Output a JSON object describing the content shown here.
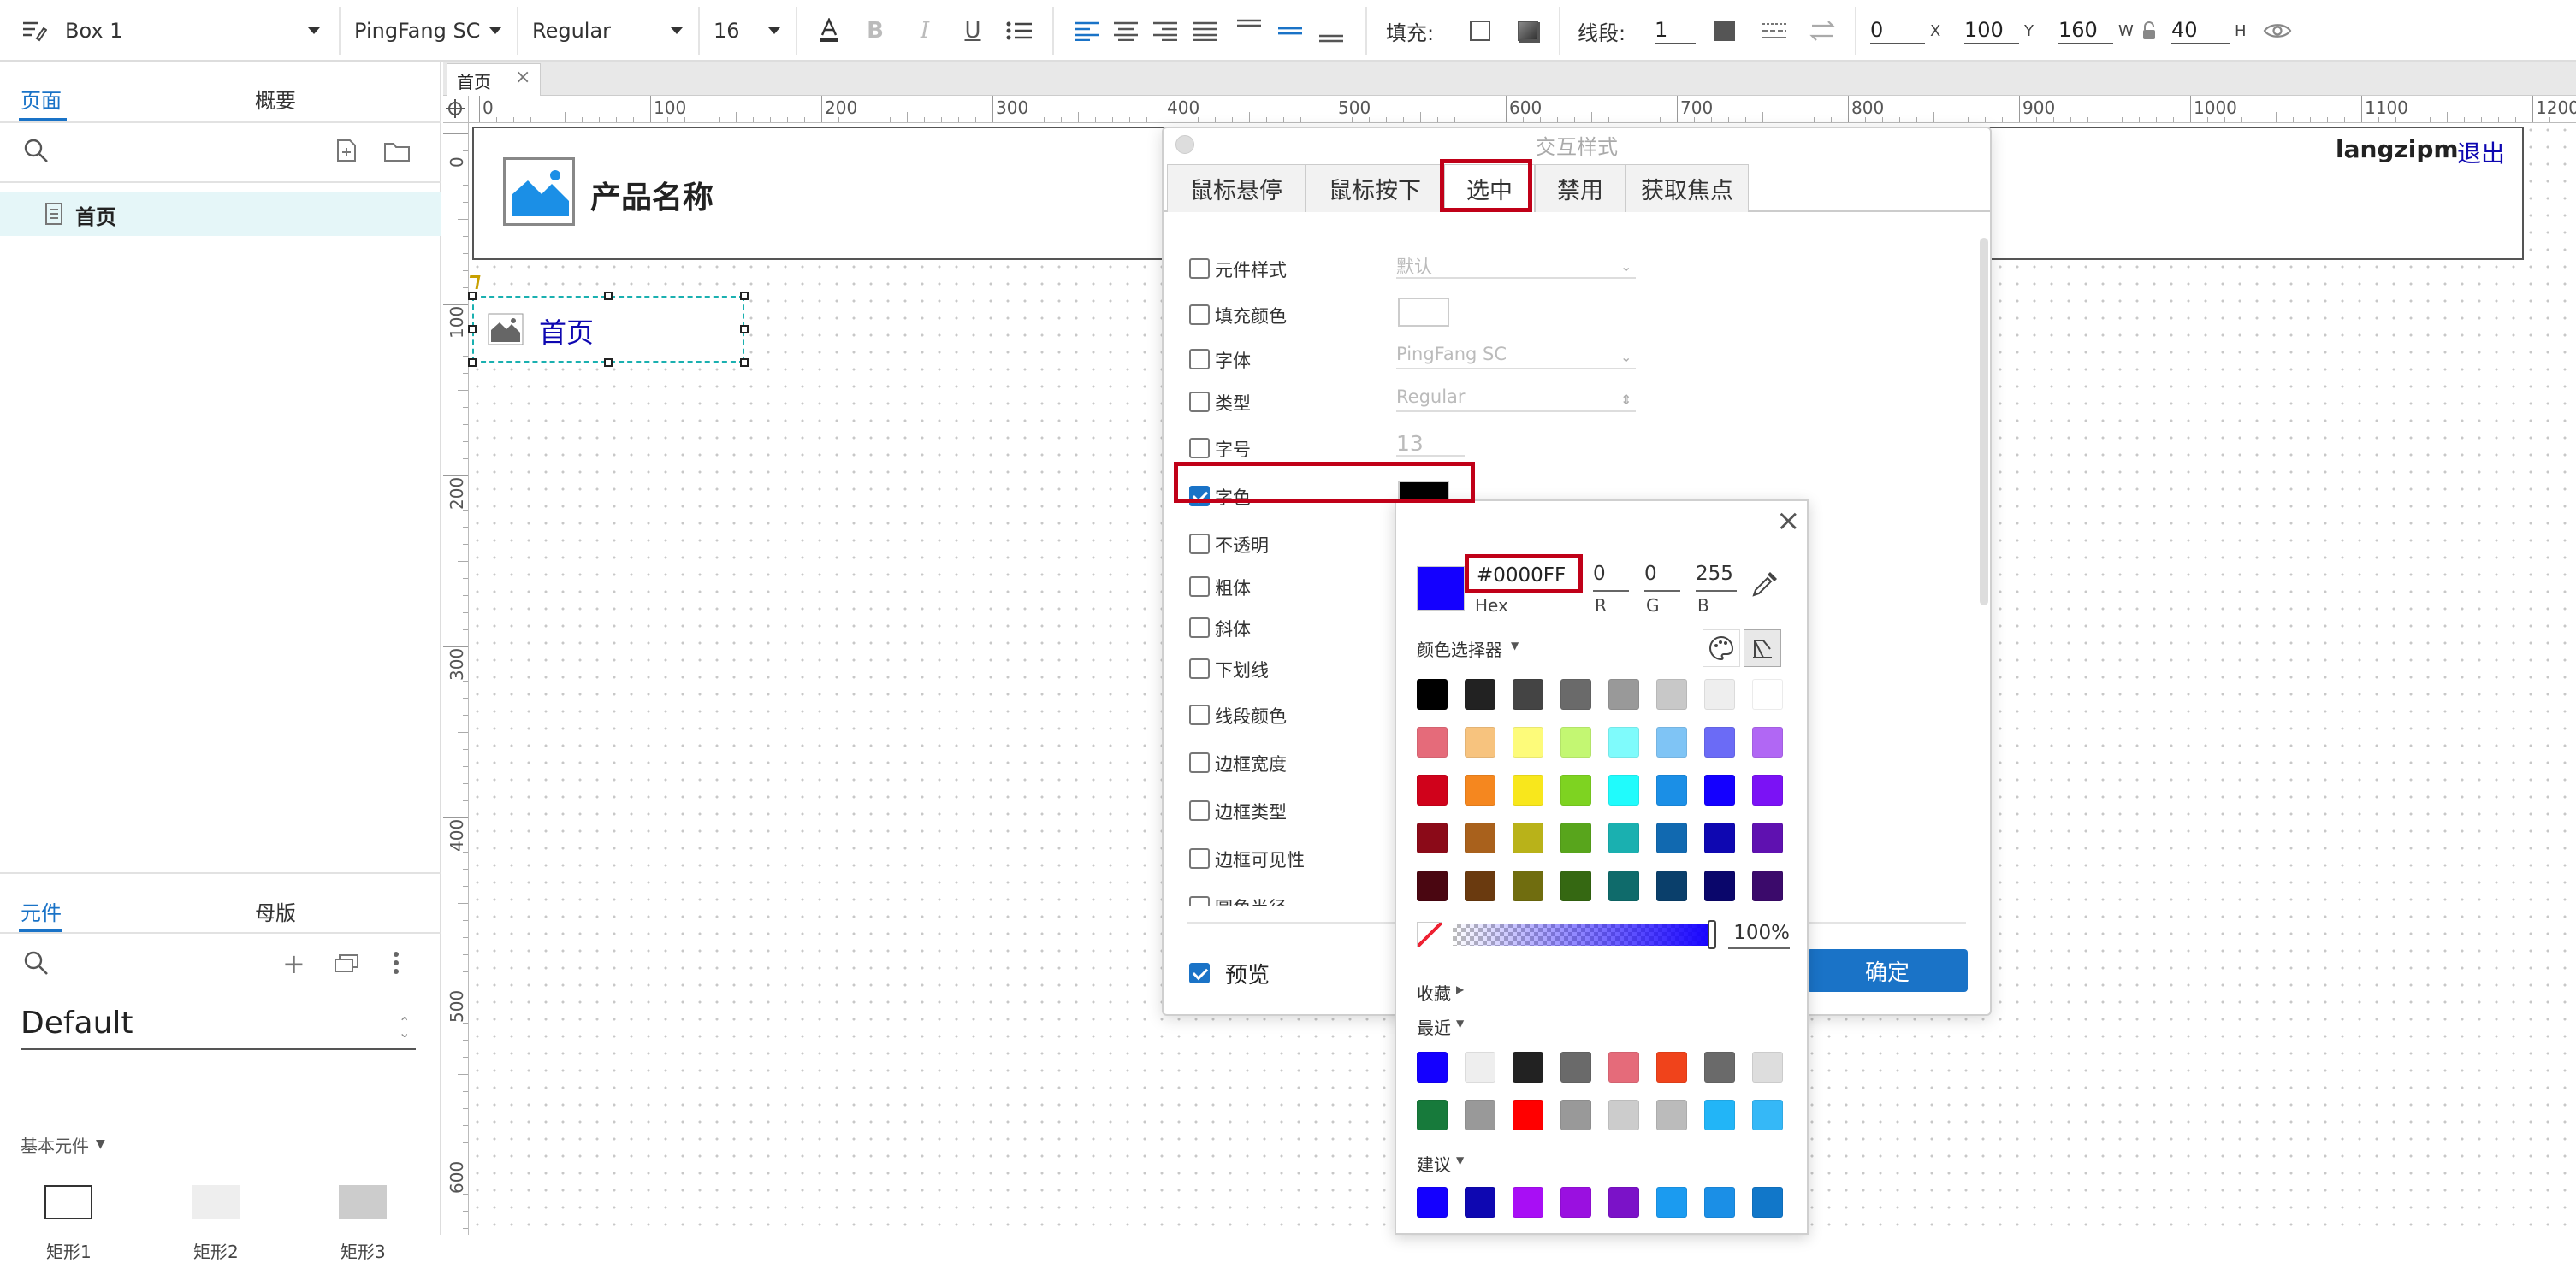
{
  "toolbar": {
    "shape_name": "Box 1",
    "font_family": "PingFang SC",
    "font_weight": "Regular",
    "font_size": "16",
    "fill_label": "填充:",
    "line_label": "线段:",
    "line_width": "1",
    "x_value": "0",
    "x_label": "X",
    "y_value": "100",
    "y_label": "Y",
    "w_value": "160",
    "w_label": "W",
    "h_value": "40",
    "h_label": "H"
  },
  "left_panel": {
    "tab_pages": "页面",
    "tab_outline": "概要",
    "page_item": "首页",
    "tab_widgets": "元件",
    "tab_masters": "母版",
    "library_name": "Default",
    "section_basic": "基本元件",
    "widgets": [
      "矩形1",
      "矩形2",
      "矩形3"
    ]
  },
  "canvas": {
    "page_tab": "首页",
    "ruler_h": [
      "0",
      "100",
      "200",
      "300",
      "400",
      "500",
      "600",
      "700",
      "800",
      "900",
      "1000",
      "1100",
      "1200"
    ],
    "ruler_v": [
      "0",
      "100",
      "200",
      "300",
      "400",
      "500",
      "600"
    ],
    "header_title": "产品名称",
    "user_name": "langzipm",
    "logout": "退出",
    "selected_label": "首页"
  },
  "dialog": {
    "title": "交互样式",
    "tabs": [
      "鼠标悬停",
      "鼠标按下",
      "选中",
      "禁用",
      "获取焦点"
    ],
    "active_tab": "选中",
    "rows": [
      {
        "label": "元件样式",
        "value": "默认"
      },
      {
        "label": "填充颜色",
        "value": ""
      },
      {
        "label": "字体",
        "value": "PingFang SC"
      },
      {
        "label": "类型",
        "value": "Regular"
      },
      {
        "label": "字号",
        "value": "13"
      },
      {
        "label": "字色",
        "value": ""
      },
      {
        "label": "不透明",
        "value": ""
      },
      {
        "label": "粗体",
        "value": ""
      },
      {
        "label": "斜体",
        "value": ""
      },
      {
        "label": "下划线",
        "value": ""
      },
      {
        "label": "线段颜色",
        "value": ""
      },
      {
        "label": "边框宽度",
        "value": ""
      },
      {
        "label": "边框类型",
        "value": ""
      },
      {
        "label": "边框可见性",
        "value": ""
      },
      {
        "label": "圆角半径",
        "value": ""
      }
    ],
    "preview_label": "预览",
    "ok_label": "确定"
  },
  "picker": {
    "hex_value": "#0000FF",
    "hex_label": "Hex",
    "r_value": "0",
    "r_label": "R",
    "g_value": "0",
    "g_label": "G",
    "b_value": "255",
    "b_label": "B",
    "selector_label": "颜色选择器",
    "opacity": "100%",
    "favorites_label": "收藏",
    "recent_label": "最近",
    "suggest_label": "建议",
    "current_color": "#1400FF",
    "grid": [
      [
        "#000000",
        "#222222",
        "#444444",
        "#6a6a6a",
        "#999999",
        "#c8c8c8",
        "#eeeeee",
        "#ffffff"
      ],
      [
        "#e56b7a",
        "#f7c37e",
        "#fdfb7a",
        "#c3f772",
        "#7ffbfc",
        "#7fc4f5",
        "#6b6bf6",
        "#b167f4"
      ],
      [
        "#d0021b",
        "#f5871f",
        "#f8e71c",
        "#7ed321",
        "#20fbfc",
        "#1b8fe6",
        "#1400ff",
        "#7b12f5"
      ],
      [
        "#8b0a18",
        "#a9611c",
        "#b9b219",
        "#58a51c",
        "#1ab0b0",
        "#1169b0",
        "#0e07b1",
        "#5f11b0"
      ],
      [
        "#4a0611",
        "#6a3a0f",
        "#706d0f",
        "#356812",
        "#0f6b6b",
        "#0a3f6b",
        "#0a066b",
        "#3b0a6b"
      ]
    ],
    "recent": [
      [
        "#1400ff",
        "#eeeeee",
        "#222222",
        "#6a6a6a",
        "#e56b7a",
        "#f0431b",
        "#6a6a6a",
        "#dddddd"
      ],
      [
        "#177a3b",
        "#999999",
        "#ff0000",
        "#999999",
        "#cccccc",
        "#bbbbbb",
        "#22b5f7",
        "#35b8f7"
      ]
    ],
    "suggest": [
      "#1400ff",
      "#0e07b1",
      "#a80ef5",
      "#9a10e0",
      "#7b12c8",
      "#1b9bf0",
      "#1b8fe6",
      "#1177c9"
    ]
  }
}
